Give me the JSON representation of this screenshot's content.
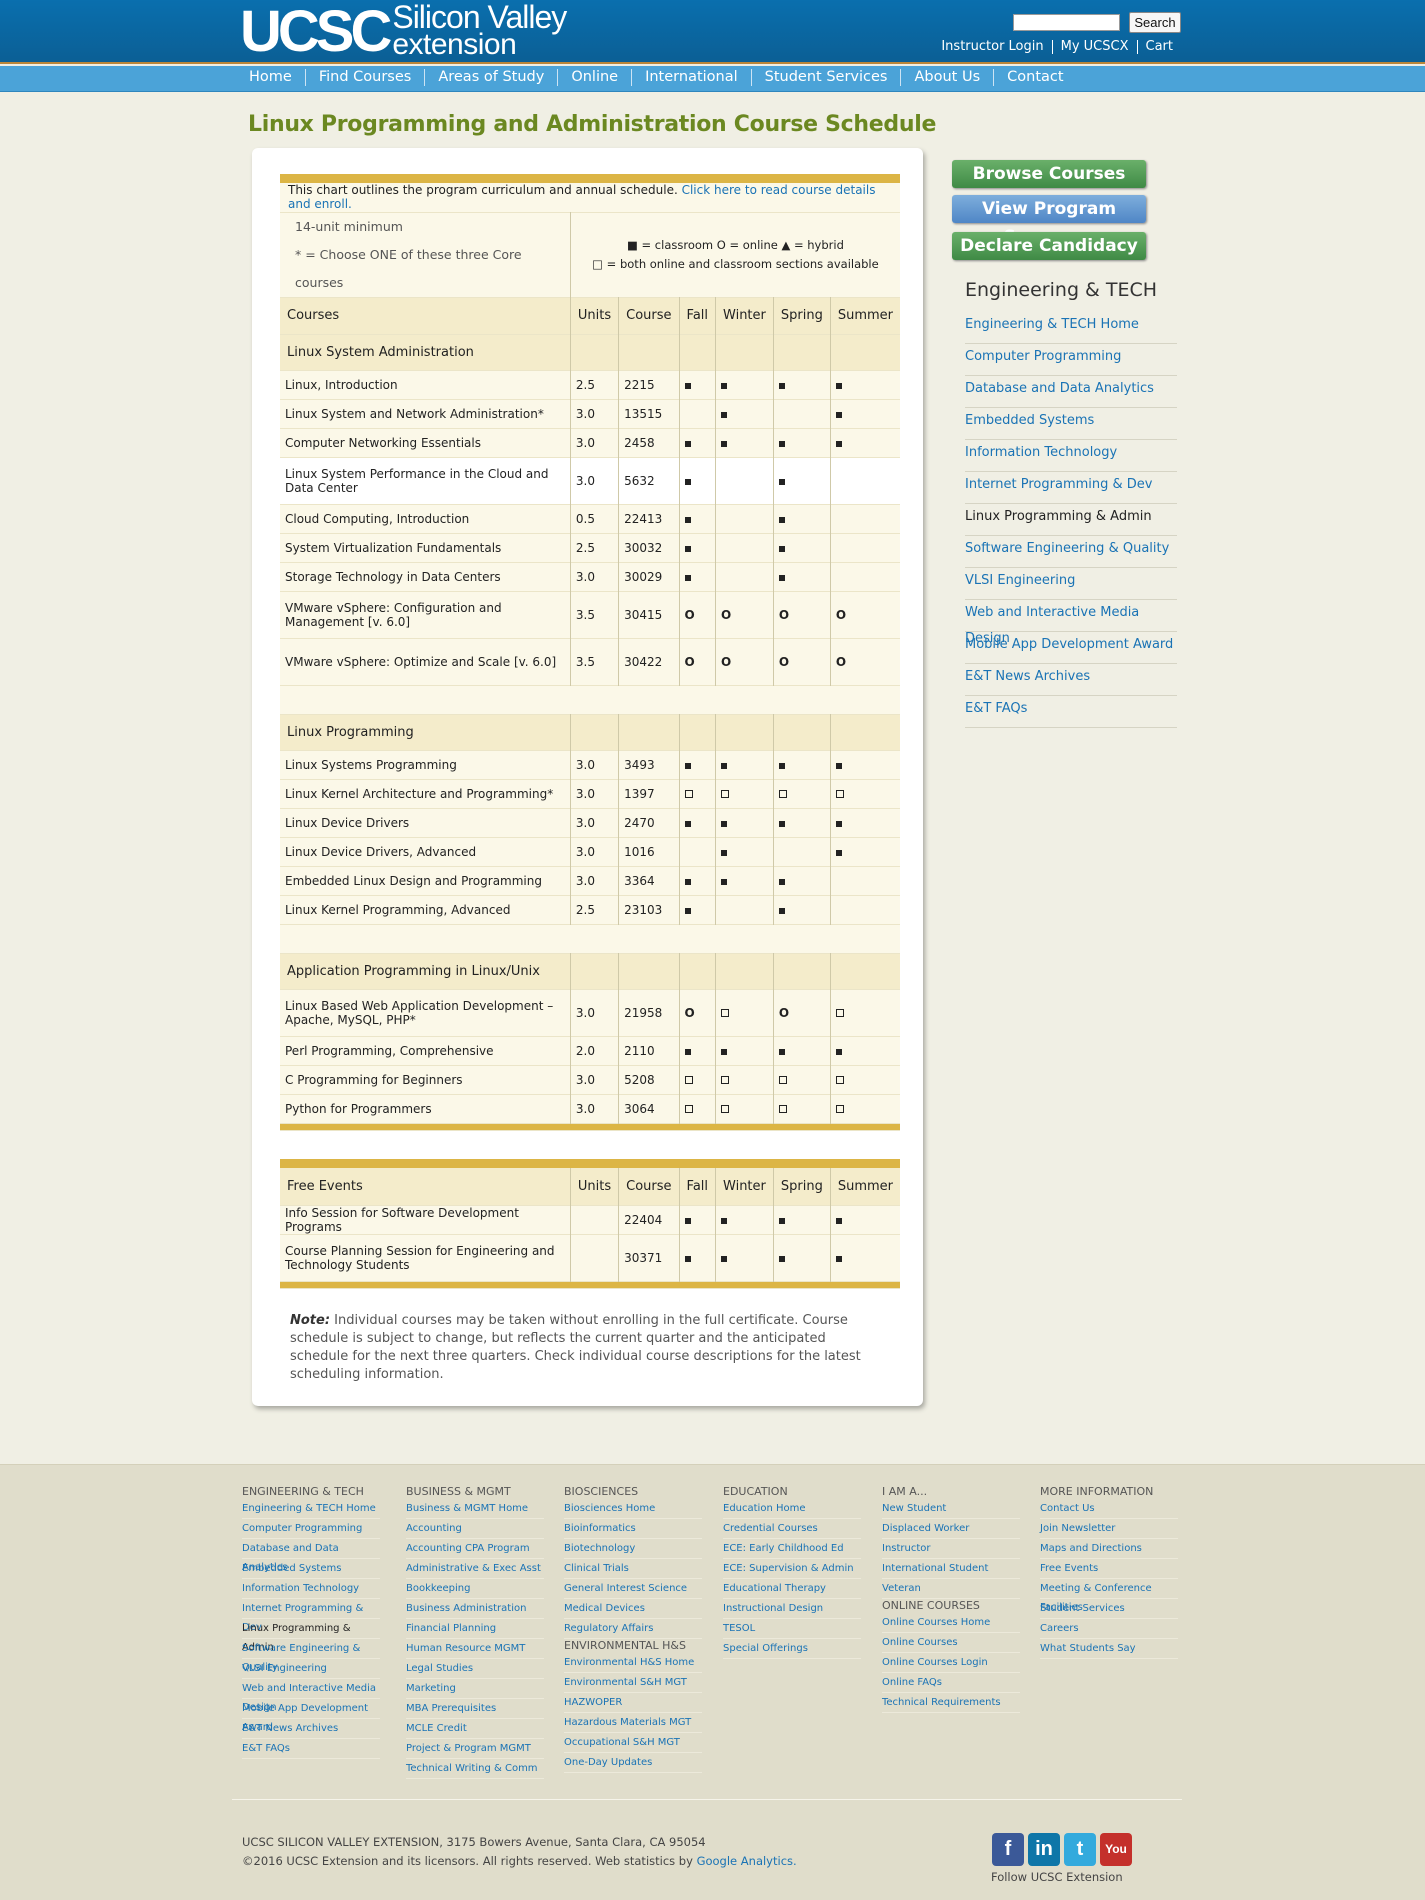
{
  "header": {
    "logo_main": "UCSC",
    "logo_sub1": "Silicon Valley",
    "logo_sub2": "extension",
    "search_placeholder": "",
    "search_button": "Search",
    "top_links": [
      "Instructor Login",
      "My UCSCX",
      "Cart"
    ]
  },
  "nav": [
    "Home",
    "Find Courses",
    "Areas of Study",
    "Online",
    "International",
    "Student Services",
    "About Us",
    "Contact"
  ],
  "page_title": "Linux Programming and Administration Course Schedule",
  "intro": {
    "text": "This chart outlines the program curriculum and annual schedule.",
    "link": "Click here to read course details and enroll.",
    "min_units": "14-unit minimum",
    "core_note": "* = Choose ONE of these three Core courses",
    "legend1": "■ = classroom  O = online  ▲ = hybrid",
    "legend2": "□ = both online and classroom sections available"
  },
  "table_headers": [
    "Courses",
    "Units",
    "Course",
    "Fall",
    "Winter",
    "Spring",
    "Summer"
  ],
  "sections": [
    {
      "title": "Linux System Administration",
      "rows": [
        {
          "name": "Linux, Introduction",
          "units": "2.5",
          "course": "2215",
          "m": [
            "s",
            "s",
            "s",
            "s"
          ]
        },
        {
          "name": "Linux System and Network Administration*",
          "units": "3.0",
          "course": "13515",
          "m": [
            "",
            "s",
            "",
            "s"
          ]
        },
        {
          "name": "Computer Networking Essentials",
          "units": "3.0",
          "course": "2458",
          "m": [
            "s",
            "s",
            "s",
            "s"
          ]
        },
        {
          "name": "Linux System Performance in the Cloud and Data Center",
          "units": "3.0",
          "course": "5632",
          "m": [
            "s",
            "",
            "s",
            ""
          ],
          "tall": true,
          "white": true
        },
        {
          "name": "Cloud Computing, Introduction",
          "units": "0.5",
          "course": "22413",
          "m": [
            "s",
            "",
            "s",
            ""
          ]
        },
        {
          "name": "System Virtualization Fundamentals",
          "units": "2.5",
          "course": "30032",
          "m": [
            "s",
            "",
            "s",
            ""
          ]
        },
        {
          "name": "Storage Technology in Data Centers",
          "units": "3.0",
          "course": "30029",
          "m": [
            "s",
            "",
            "s",
            ""
          ]
        },
        {
          "name": "VMware vSphere: Configuration and Management [v. 6.0]",
          "units": "3.5",
          "course": "30415",
          "m": [
            "o",
            "o",
            "o",
            "o"
          ],
          "tall": true
        },
        {
          "name": "VMware vSphere: Optimize and Scale [v. 6.0]",
          "units": "3.5",
          "course": "30422",
          "m": [
            "o",
            "o",
            "o",
            "o"
          ],
          "tall": true
        }
      ]
    },
    {
      "title": "Linux Programming",
      "rows": [
        {
          "name": "Linux Systems Programming",
          "units": "3.0",
          "course": "3493",
          "m": [
            "s",
            "s",
            "s",
            "s"
          ]
        },
        {
          "name": "Linux Kernel Architecture and Programming*",
          "units": "3.0",
          "course": "1397",
          "m": [
            "b",
            "b",
            "b",
            "b"
          ]
        },
        {
          "name": "Linux Device Drivers",
          "units": "3.0",
          "course": "2470",
          "m": [
            "s",
            "s",
            "s",
            "s"
          ]
        },
        {
          "name": "Linux Device Drivers, Advanced",
          "units": "3.0",
          "course": "1016",
          "m": [
            "",
            "s",
            "",
            "s"
          ]
        },
        {
          "name": "Embedded Linux Design and Programming",
          "units": "3.0",
          "course": "3364",
          "m": [
            "s",
            "s",
            "s",
            ""
          ]
        },
        {
          "name": "Linux Kernel Programming, Advanced",
          "units": "2.5",
          "course": "23103",
          "m": [
            "s",
            "",
            "s",
            ""
          ]
        }
      ]
    },
    {
      "title": "Application Programming in Linux/Unix",
      "rows": [
        {
          "name": "Linux Based Web Application Development – Apache, MySQL, PHP*",
          "units": "3.0",
          "course": "21958",
          "m": [
            "o",
            "b",
            "o",
            "b"
          ],
          "tall": true
        },
        {
          "name": "Perl Programming, Comprehensive",
          "units": "2.0",
          "course": "2110",
          "m": [
            "s",
            "s",
            "s",
            "s"
          ]
        },
        {
          "name": "C Programming for Beginners",
          "units": "3.0",
          "course": "5208",
          "m": [
            "b",
            "b",
            "b",
            "b"
          ]
        },
        {
          "name": "Python for Programmers",
          "units": "3.0",
          "course": "3064",
          "m": [
            "b",
            "b",
            "b",
            "b"
          ]
        }
      ]
    }
  ],
  "free_events": {
    "headers": [
      "Free Events",
      "Units",
      "Course",
      "Fall",
      "Winter",
      "Spring",
      "Summer"
    ],
    "rows": [
      {
        "name": "Info Session for Software Development Programs",
        "units": "",
        "course": "22404",
        "m": [
          "s",
          "s",
          "s",
          "s"
        ]
      },
      {
        "name": "Course Planning Session for Engineering and Technology Students",
        "units": "",
        "course": "30371",
        "m": [
          "s",
          "s",
          "s",
          "s"
        ],
        "tall": true
      }
    ]
  },
  "note": {
    "label": "Note:",
    "text": " Individual courses may be taken without enrolling in the full certificate. Course schedule is subject to change, but reflects the current quarter and the anticipated schedule for the next three quarters. Check individual course descriptions for the latest scheduling information."
  },
  "sidebar": {
    "buttons": [
      "Browse Courses",
      "View Program Summary",
      "Declare Candidacy"
    ],
    "heading": "Engineering & TECH",
    "links": [
      "Engineering & TECH Home",
      "Computer Programming",
      "Database and Data Analytics",
      "Embedded Systems",
      "Information Technology",
      "Internet Programming & Dev",
      "Linux Programming & Admin",
      "Software Engineering & Quality",
      "VLSI Engineering",
      "Web and Interactive Media Design",
      "Mobile App Development Award",
      "E&T News Archives",
      "E&T FAQs"
    ],
    "current": "Linux Programming & Admin"
  },
  "footer": {
    "columns": [
      {
        "groups": [
          {
            "heading": "ENGINEERING & TECH",
            "links": [
              "Engineering & TECH Home",
              "Computer Programming",
              "Database and Data Analytics",
              "Embedded Systems",
              "Information Technology",
              "Internet Programming & Dev",
              "Linux Programming & Admin",
              "Software Engineering & Quality",
              "VLSI Engineering",
              "Web and Interactive Media Design",
              "Mobile App Development Award",
              "E&T News Archives",
              "E&T FAQs"
            ]
          }
        ]
      },
      {
        "groups": [
          {
            "heading": "BUSINESS & MGMT",
            "links": [
              "Business & MGMT Home",
              "Accounting",
              "Accounting CPA Program",
              "Administrative & Exec Asst",
              "Bookkeeping",
              "Business Administration",
              "Financial Planning",
              "Human Resource MGMT",
              "Legal Studies",
              "Marketing",
              "MBA Prerequisites",
              "MCLE Credit",
              "Project & Program MGMT",
              "Technical Writing & Comm"
            ]
          }
        ]
      },
      {
        "groups": [
          {
            "heading": "BIOSCIENCES",
            "links": [
              "Biosciences Home",
              "Bioinformatics",
              "Biotechnology",
              "Clinical Trials",
              "General Interest Science",
              "Medical Devices",
              "Regulatory Affairs"
            ]
          },
          {
            "heading": "ENVIRONMENTAL H&S",
            "links": [
              "Environmental H&S Home",
              "Environmental S&H MGT",
              "HAZWOPER",
              "Hazardous Materials MGT",
              "Occupational S&H MGT",
              "One-Day Updates"
            ]
          }
        ]
      },
      {
        "groups": [
          {
            "heading": "EDUCATION",
            "links": [
              "Education Home",
              "Credential Courses",
              "ECE: Early Childhood Ed",
              "ECE: Supervision & Admin",
              "Educational Therapy",
              "Instructional Design",
              "TESOL",
              "Special Offerings"
            ]
          }
        ]
      },
      {
        "groups": [
          {
            "heading": "I AM A...",
            "links": [
              "New Student",
              "Displaced Worker",
              "Instructor",
              "International Student",
              "Veteran"
            ]
          },
          {
            "heading": "ONLINE COURSES",
            "links": [
              "Online Courses Home",
              "Online Courses",
              "Online Courses Login",
              "Online FAQs",
              "Technical Requirements"
            ]
          }
        ]
      },
      {
        "groups": [
          {
            "heading": "MORE INFORMATION",
            "links": [
              "Contact Us",
              "Join Newsletter",
              "Maps and Directions",
              "Free Events",
              "Meeting & Conference Facilities",
              "Student Services",
              "Careers",
              "What Students Say"
            ]
          }
        ]
      }
    ],
    "address": "UCSC SILICON VALLEY EXTENSION, 3175 Bowers Avenue, Santa Clara, CA 95054",
    "copyright": "©2016 UCSC Extension and its licensors. All rights reserved. Web statistics by",
    "analytics_link": "Google Analytics.",
    "follow": "Follow UCSC Extension",
    "social": [
      {
        "name": "facebook-icon",
        "glyph": "f",
        "color": "#3b5998"
      },
      {
        "name": "linkedin-icon",
        "glyph": "in",
        "color": "#0e76a8"
      },
      {
        "name": "twitter-icon",
        "glyph": "t",
        "color": "#33aadd"
      },
      {
        "name": "youtube-icon",
        "glyph": "You",
        "color": "#c4302b"
      }
    ]
  }
}
